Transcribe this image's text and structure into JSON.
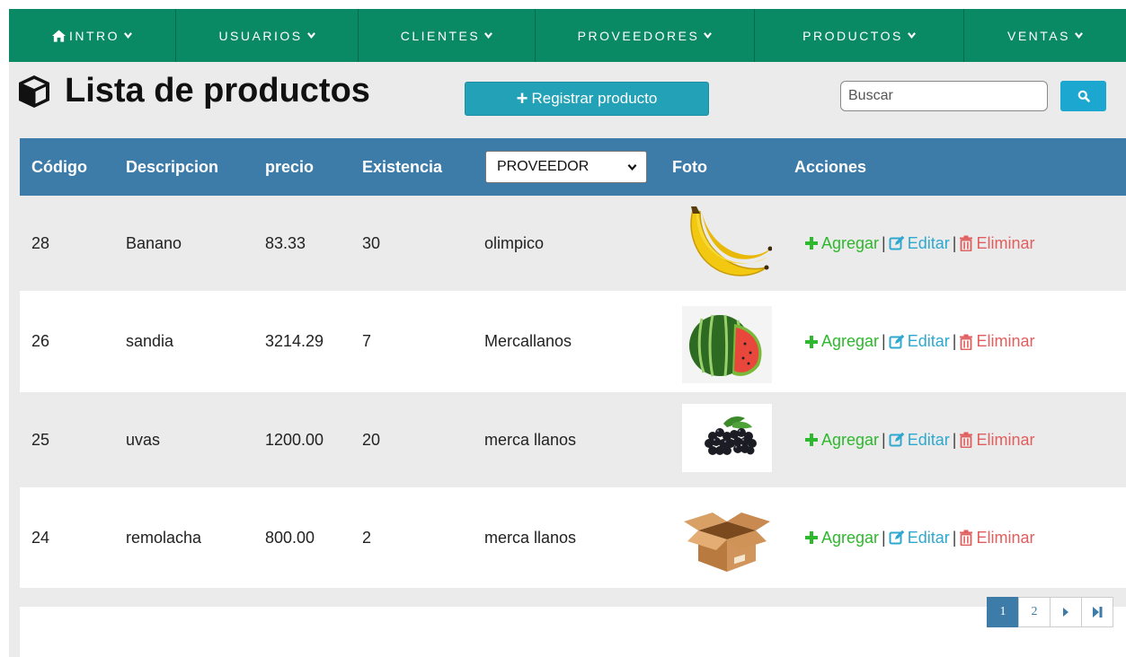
{
  "nav": {
    "items": [
      {
        "label": "INTRO",
        "icon": "home-icon"
      },
      {
        "label": "USUARIOS"
      },
      {
        "label": "CLIENTES"
      },
      {
        "label": "PROVEEDORES"
      },
      {
        "label": "PRODUCTOS"
      },
      {
        "label": "VENTAS"
      }
    ]
  },
  "header": {
    "title": "Lista de productos",
    "register_label": "Registrar producto",
    "search_placeholder": "Buscar"
  },
  "table": {
    "headers": {
      "codigo": "Código",
      "descripcion": "Descripcion",
      "precio": "precio",
      "existencia": "Existencia",
      "proveedor_select": "PROVEEDOR",
      "foto": "Foto",
      "acciones": "Acciones"
    },
    "actions": {
      "add": "Agregar",
      "edit": "Editar",
      "delete": "Eliminar"
    },
    "rows": [
      {
        "codigo": "28",
        "descripcion": "Banano",
        "precio": "83.33",
        "existencia": "30",
        "proveedor": "olimpico",
        "foto": "banana-image"
      },
      {
        "codigo": "26",
        "descripcion": "sandia",
        "precio": "3214.29",
        "existencia": "7",
        "proveedor": "Mercallanos",
        "foto": "watermelon-image"
      },
      {
        "codigo": "25",
        "descripcion": "uvas",
        "precio": "1200.00",
        "existencia": "20",
        "proveedor": "merca llanos",
        "foto": "blackberries-image"
      },
      {
        "codigo": "24",
        "descripcion": "remolacha",
        "precio": "800.00",
        "existencia": "2",
        "proveedor": "merca llanos",
        "foto": "cardboard-box-image"
      }
    ]
  },
  "pagination": {
    "pages": [
      "1",
      "2"
    ],
    "current": "1"
  },
  "colors": {
    "nav": "#0a8a64",
    "table_header": "#3d7ba8",
    "register_button": "#23a1b7",
    "search_button": "#1ba7d0",
    "add": "#2eb82e",
    "edit": "#2fa8cf",
    "delete": "#e05e5e"
  }
}
